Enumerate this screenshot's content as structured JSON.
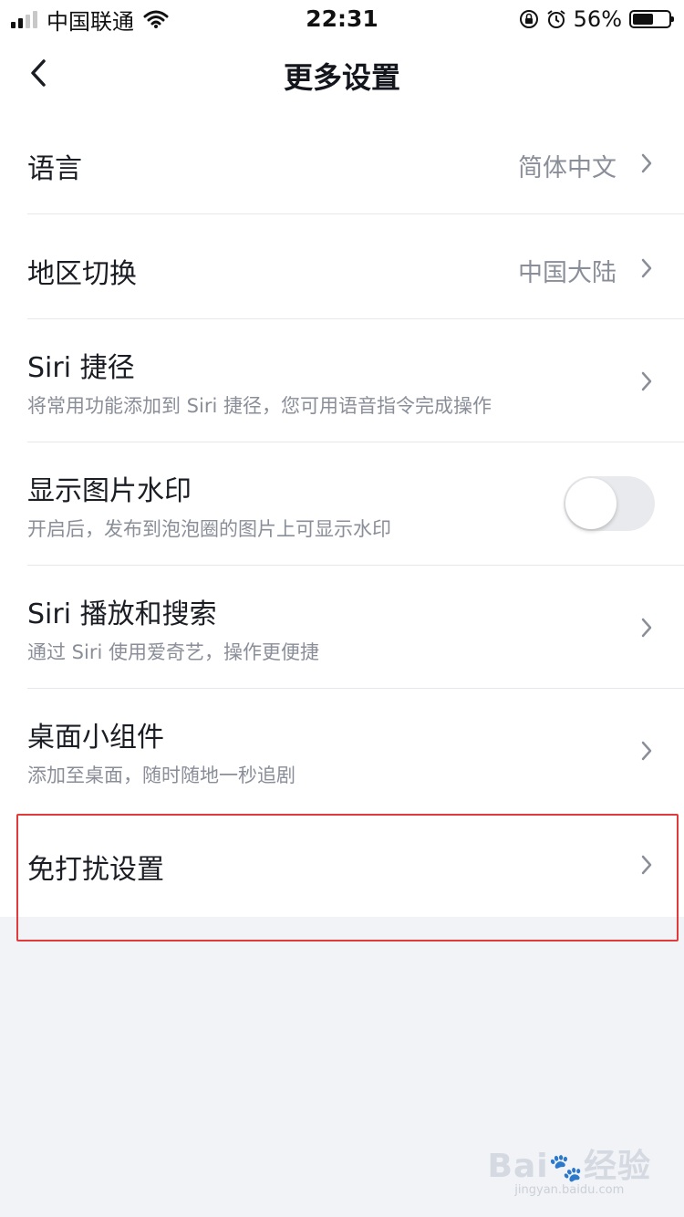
{
  "status_bar": {
    "carrier": "中国联通",
    "time": "22:31",
    "battery": "56%",
    "icons": [
      "signal-icon",
      "wifi-icon",
      "rotation-lock-icon",
      "alarm-icon",
      "battery-icon"
    ]
  },
  "nav": {
    "title": "更多设置",
    "back_icon": "chevron-left-icon"
  },
  "settings": {
    "language": {
      "label": "语言",
      "value": "简体中文"
    },
    "region": {
      "label": "地区切换",
      "value": "中国大陆"
    },
    "siri_shortcut": {
      "label": "Siri 捷径",
      "sub": "将常用功能添加到 Siri 捷径，您可用语音指令完成操作"
    },
    "watermark": {
      "label": "显示图片水印",
      "sub": "开启后，发布到泡泡圈的图片上可显示水印",
      "enabled": false
    },
    "siri_search": {
      "label": "Siri 播放和搜索",
      "sub": "通过 Siri 使用爱奇艺，操作更便捷"
    },
    "widget": {
      "label": "桌面小组件",
      "sub": "添加至桌面，随时随地一秒追剧"
    },
    "dnd": {
      "label": "免打扰设置"
    }
  },
  "watermark_logo": {
    "main": "Bai du 经验",
    "sub": "jingyan.baidu.com"
  },
  "colors": {
    "highlight": "#e03a3a",
    "background": "#f1f3f7",
    "toggle_off": "#e9eaed"
  }
}
